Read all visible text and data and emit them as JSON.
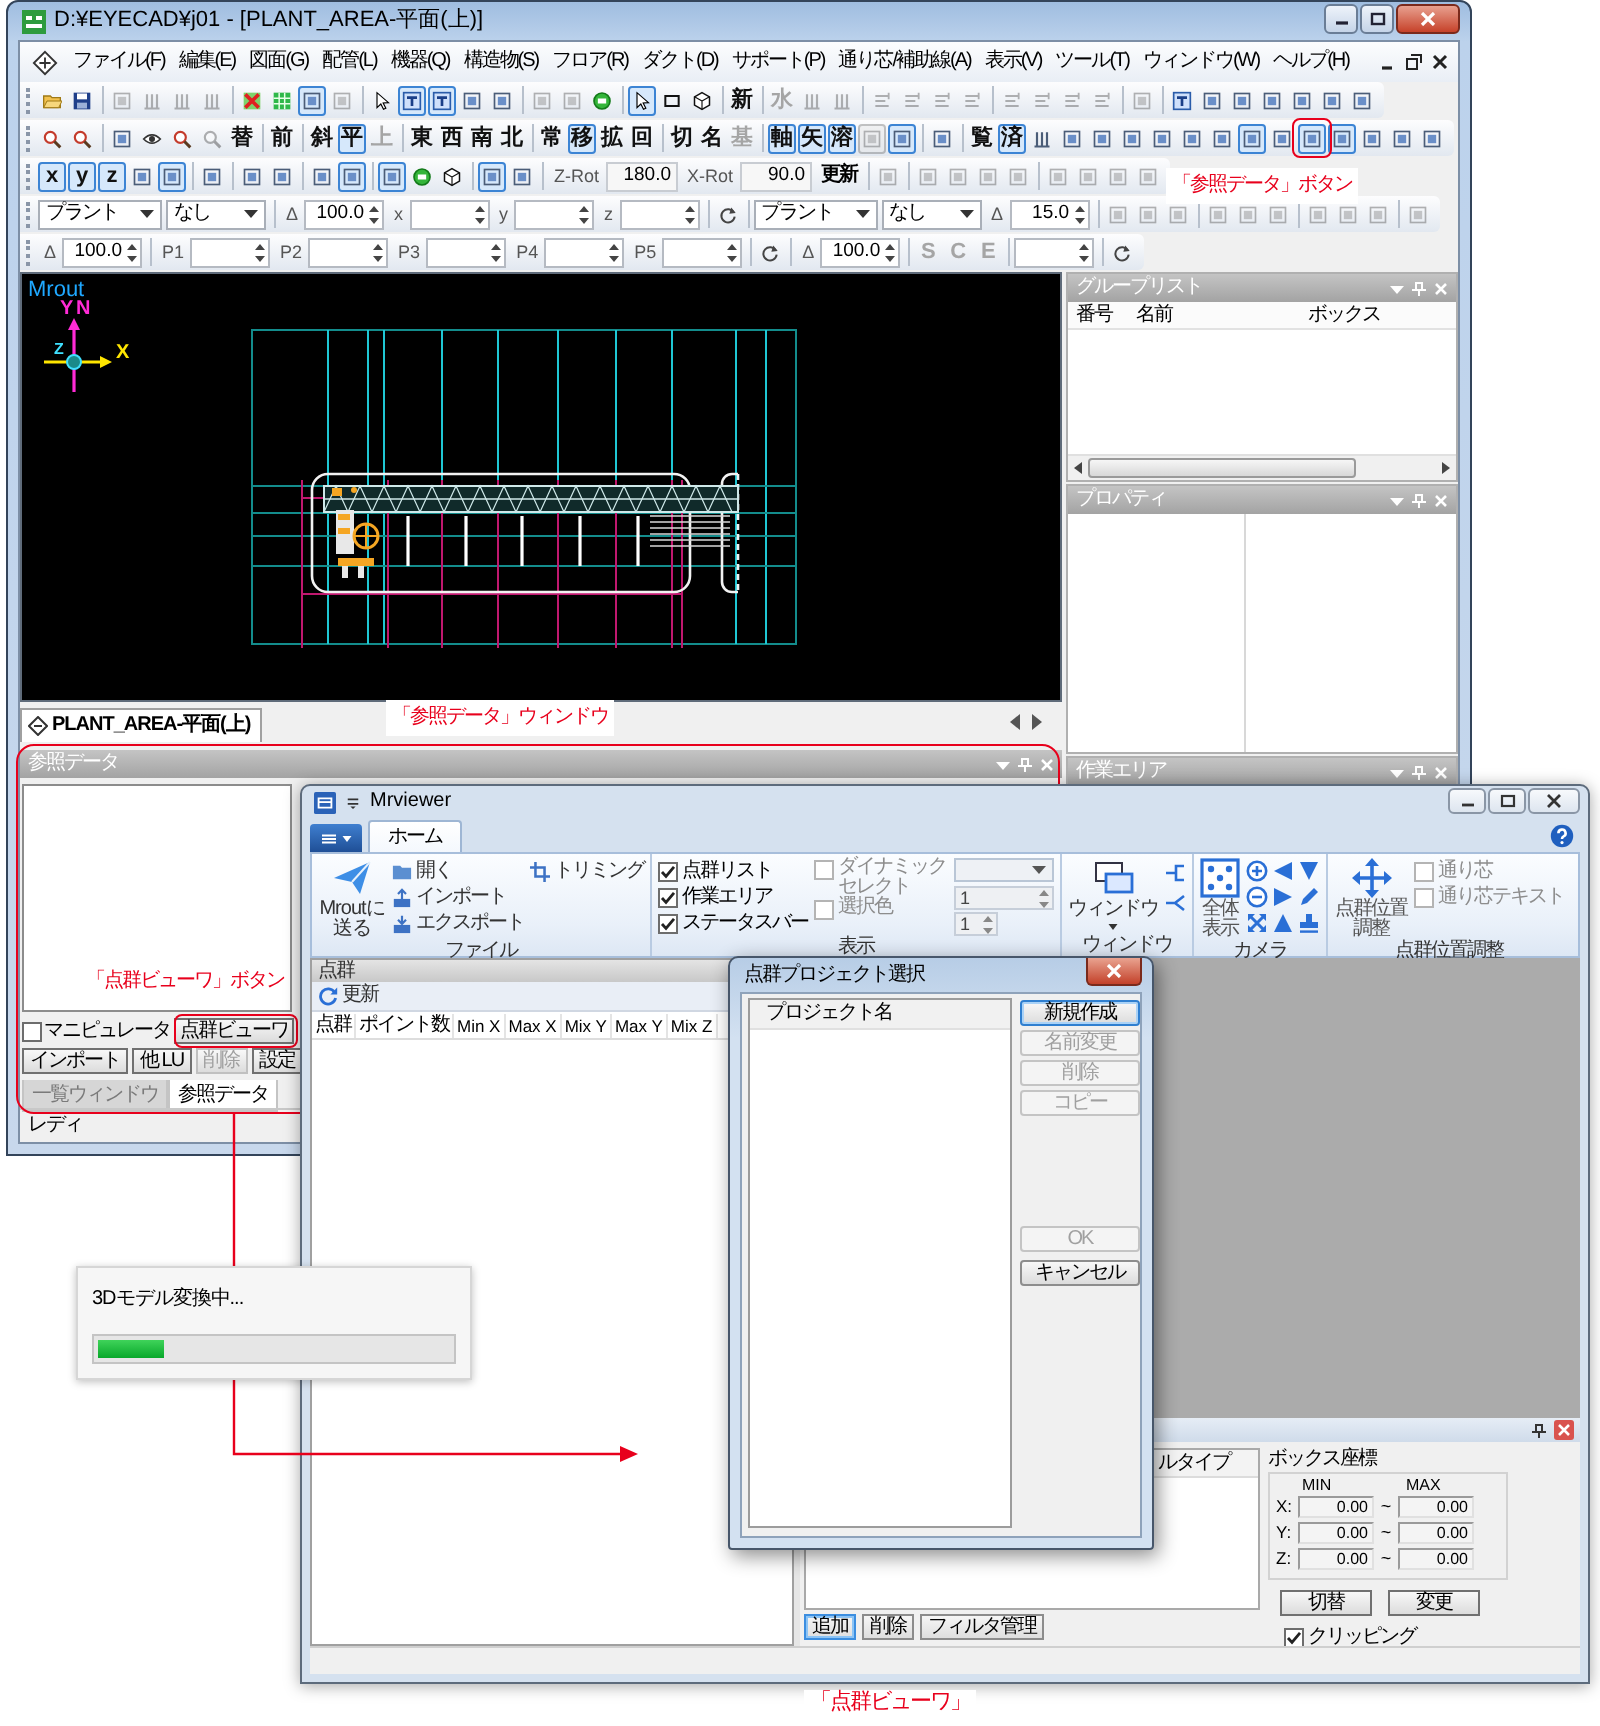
{
  "main_window": {
    "title": "D:¥EYECAD¥j01 - [PLANT_AREA-平面(上)]",
    "menu": [
      "ファイル(F)",
      "編集(E)",
      "図面(G)",
      "配管(L)",
      "機器(Q)",
      "構造物(S)",
      "フロア(R)",
      "ダクト(D)",
      "サポート(P)",
      "通り芯/補助線(A)",
      "表示(V)",
      "ツール(T)",
      "ウィンドウ(W)",
      "ヘルプ(H)"
    ],
    "toolbars": [
      {
        "groups": [
          {
            "kind": "tools",
            "items": [
              {
                "kind": "open",
                "on": false,
                "disabled": false
              },
              {
                "kind": "save",
                "on": false,
                "disabled": false
              }
            ]
          },
          {
            "kind": "tools",
            "items": [
              {
                "kind": "frame",
                "on": false,
                "disabled": true
              },
              {
                "kind": "bars",
                "on": false,
                "disabled": true
              },
              {
                "kind": "bars",
                "on": false,
                "disabled": true
              },
              {
                "kind": "bars",
                "on": false,
                "disabled": true
              }
            ]
          },
          {
            "kind": "tools",
            "items": [
              {
                "kind": "cross",
                "on": false,
                "disabled": false
              },
              {
                "kind": "grid",
                "on": false,
                "disabled": false
              },
              {
                "kind": "frame",
                "on": true,
                "disabled": false
              },
              {
                "kind": "frame",
                "on": false,
                "disabled": true
              }
            ]
          },
          {
            "kind": "tools",
            "items": [
              {
                "kind": "cursor",
                "on": false,
                "disabled": false
              },
              {
                "kind": "tee",
                "on": true,
                "disabled": false
              },
              {
                "kind": "tee",
                "on": true,
                "disabled": false
              },
              {
                "kind": "frame",
                "on": false,
                "disabled": false
              },
              {
                "kind": "frame",
                "on": false,
                "disabled": false
              }
            ]
          },
          {
            "kind": "tools",
            "items": [
              {
                "kind": "frame",
                "on": false,
                "disabled": true
              },
              {
                "kind": "frame",
                "on": false,
                "disabled": true
              },
              {
                "kind": "ring",
                "on": false,
                "disabled": false
              }
            ]
          },
          {
            "kind": "tools",
            "items": [
              {
                "kind": "cursor",
                "on": true,
                "disabled": false
              },
              {
                "kind": "rect",
                "on": false,
                "disabled": false
              },
              {
                "kind": "cube",
                "on": false,
                "disabled": false
              }
            ]
          },
          {
            "kind": "tools",
            "items": [
              {
                "kind": "glyph",
                "text": "新",
                "on": false,
                "disabled": false
              }
            ]
          },
          {
            "kind": "tools",
            "items": [
              {
                "kind": "glyph",
                "text": "水",
                "on": false,
                "disabled": true
              },
              {
                "kind": "bars",
                "on": false,
                "disabled": true
              },
              {
                "kind": "bars",
                "on": false,
                "disabled": true
              }
            ]
          },
          {
            "kind": "tools",
            "items": [
              {
                "kind": "lines",
                "on": false,
                "disabled": true
              },
              {
                "kind": "lines",
                "on": false,
                "disabled": true
              },
              {
                "kind": "lines",
                "on": false,
                "disabled": true
              },
              {
                "kind": "lines",
                "on": false,
                "disabled": true
              }
            ]
          },
          {
            "kind": "tools",
            "items": [
              {
                "kind": "lines",
                "on": false,
                "disabled": true
              },
              {
                "kind": "lines",
                "on": false,
                "disabled": true
              },
              {
                "kind": "lines",
                "on": false,
                "disabled": true
              },
              {
                "kind": "lines",
                "on": false,
                "disabled": true
              }
            ]
          },
          {
            "kind": "tools",
            "items": [
              {
                "kind": "frame",
                "on": false,
                "disabled": true
              }
            ]
          },
          {
            "kind": "tools",
            "items": [
              {
                "kind": "tee",
                "on": false,
                "disabled": false
              },
              {
                "kind": "frame",
                "on": false,
                "disabled": false
              },
              {
                "kind": "frame",
                "on": false,
                "disabled": false
              },
              {
                "kind": "frame",
                "on": false,
                "disabled": false
              },
              {
                "kind": "frame",
                "on": false,
                "disabled": false
              },
              {
                "kind": "frame",
                "on": false,
                "disabled": false
              },
              {
                "kind": "frame",
                "on": false,
                "disabled": false
              }
            ]
          }
        ]
      },
      {
        "groups": [
          {
            "kind": "tools",
            "items": [
              {
                "kind": "zoom",
                "on": false,
                "disabled": false
              },
              {
                "kind": "zoom",
                "on": false,
                "disabled": false
              }
            ]
          },
          {
            "kind": "tools",
            "items": [
              {
                "kind": "frame",
                "on": false,
                "disabled": false
              },
              {
                "kind": "eye",
                "on": false,
                "disabled": false
              },
              {
                "kind": "zoom",
                "on": false,
                "disabled": false
              },
              {
                "kind": "zoom",
                "on": false,
                "disabled": true
              },
              {
                "kind": "glyph",
                "text": "替",
                "on": false,
                "disabled": false
              }
            ]
          },
          {
            "kind": "tools",
            "items": [
              {
                "kind": "glyph",
                "text": "前",
                "on": false,
                "disabled": false
              }
            ]
          },
          {
            "kind": "tools",
            "items": [
              {
                "kind": "glyph",
                "text": "斜",
                "on": false,
                "disabled": false
              },
              {
                "kind": "glyph",
                "text": "平",
                "on": true,
                "disabled": false
              },
              {
                "kind": "glyph",
                "text": "上",
                "on": false,
                "disabled": true
              }
            ]
          },
          {
            "kind": "tools",
            "items": [
              {
                "kind": "glyph",
                "text": "東",
                "on": false,
                "disabled": false
              },
              {
                "kind": "glyph",
                "text": "西",
                "on": false,
                "disabled": false
              },
              {
                "kind": "glyph",
                "text": "南",
                "on": false,
                "disabled": false
              },
              {
                "kind": "glyph",
                "text": "北",
                "on": false,
                "disabled": false
              }
            ]
          },
          {
            "kind": "tools",
            "items": [
              {
                "kind": "glyph",
                "text": "常",
                "on": false,
                "disabled": false
              },
              {
                "kind": "glyph",
                "text": "移",
                "on": true,
                "disabled": false
              },
              {
                "kind": "glyph",
                "text": "拡",
                "on": false,
                "disabled": false
              },
              {
                "kind": "glyph",
                "text": "回",
                "on": false,
                "disabled": false
              }
            ]
          },
          {
            "kind": "tools",
            "items": [
              {
                "kind": "glyph",
                "text": "切",
                "on": false,
                "disabled": false
              },
              {
                "kind": "glyph",
                "text": "名",
                "on": false,
                "disabled": false
              },
              {
                "kind": "glyph",
                "text": "基",
                "on": false,
                "disabled": true
              }
            ]
          },
          {
            "kind": "tools",
            "items": [
              {
                "kind": "glyph",
                "text": "軸",
                "on": true,
                "disabled": false
              },
              {
                "kind": "glyph",
                "text": "矢",
                "on": true,
                "disabled": false
              },
              {
                "kind": "glyph",
                "text": "溶",
                "on": true,
                "disabled": false
              },
              {
                "kind": "frame",
                "on": true,
                "disabled": true
              },
              {
                "kind": "frame",
                "on": true,
                "disabled": false
              }
            ]
          },
          {
            "kind": "tools",
            "items": [
              {
                "kind": "frame",
                "on": false,
                "disabled": false
              }
            ]
          },
          {
            "kind": "tools",
            "items": [
              {
                "kind": "glyph",
                "text": "覧",
                "on": false,
                "disabled": false
              },
              {
                "kind": "glyph",
                "text": "済",
                "on": true,
                "disabled": false
              },
              {
                "kind": "bars",
                "on": false,
                "disabled": false
              },
              {
                "kind": "frame",
                "on": false,
                "disabled": false
              },
              {
                "kind": "frame",
                "on": false,
                "disabled": false
              },
              {
                "kind": "frame",
                "on": false,
                "disabled": false
              },
              {
                "kind": "frame",
                "on": false,
                "disabled": false
              },
              {
                "kind": "frame",
                "on": false,
                "disabled": false
              },
              {
                "kind": "frame",
                "on": false,
                "disabled": false
              },
              {
                "kind": "frame",
                "on": true,
                "disabled": false
              },
              {
                "kind": "frame",
                "on": false,
                "disabled": false
              },
              {
                "kind": "frame",
                "on": true,
                "disabled": false
              },
              {
                "kind": "frame",
                "on": true,
                "disabled": false
              },
              {
                "kind": "frame",
                "on": false,
                "disabled": false
              },
              {
                "kind": "frame",
                "on": false,
                "disabled": false
              },
              {
                "kind": "frame",
                "on": false,
                "disabled": false
              }
            ]
          }
        ]
      },
      {
        "groups": [
          {
            "kind": "tools",
            "items": [
              {
                "kind": "glyph",
                "text": "x",
                "on": true,
                "disabled": false
              },
              {
                "kind": "glyph",
                "text": "y",
                "on": true,
                "disabled": false
              },
              {
                "kind": "glyph",
                "text": "z",
                "on": true,
                "disabled": false
              },
              {
                "kind": "frame",
                "on": false,
                "disabled": false
              },
              {
                "kind": "frame",
                "on": true,
                "disabled": false
              }
            ]
          },
          {
            "kind": "tools",
            "items": [
              {
                "kind": "frame",
                "on": false,
                "disabled": false
              }
            ]
          },
          {
            "kind": "tools",
            "items": [
              {
                "kind": "frame",
                "on": false,
                "disabled": false
              },
              {
                "kind": "frame",
                "on": false,
                "disabled": false
              }
            ]
          },
          {
            "kind": "tools",
            "items": [
              {
                "kind": "frame",
                "on": false,
                "disabled": false
              },
              {
                "kind": "frame",
                "on": true,
                "disabled": false
              }
            ]
          },
          {
            "kind": "tools",
            "items": [
              {
                "kind": "frame",
                "on": true,
                "disabled": false
              },
              {
                "kind": "ring",
                "on": false,
                "disabled": false
              },
              {
                "kind": "cube",
                "on": false,
                "disabled": false
              }
            ]
          },
          {
            "kind": "tools",
            "items": [
              {
                "kind": "frame",
                "on": true,
                "disabled": false
              },
              {
                "kind": "frame",
                "on": false,
                "disabled": false
              }
            ]
          },
          {
            "kind": "fields",
            "items": [
              {
                "kind": "label",
                "text": "Z-Rot"
              },
              {
                "kind": "field",
                "value": "180.0"
              },
              {
                "kind": "label",
                "text": "X-Rot"
              },
              {
                "kind": "field",
                "value": "90.0"
              },
              {
                "kind": "button",
                "text": "更新"
              }
            ]
          },
          {
            "kind": "tools",
            "items": [
              {
                "kind": "frame",
                "on": false,
                "disabled": true
              }
            ]
          },
          {
            "kind": "tools",
            "items": [
              {
                "kind": "frame",
                "on": false,
                "disabled": true
              },
              {
                "kind": "frame",
                "on": false,
                "disabled": true
              },
              {
                "kind": "frame",
                "on": false,
                "disabled": true
              },
              {
                "kind": "frame",
                "on": false,
                "disabled": true
              }
            ]
          },
          {
            "kind": "tools",
            "items": [
              {
                "kind": "frame",
                "on": false,
                "disabled": true
              },
              {
                "kind": "frame",
                "on": false,
                "disabled": true
              },
              {
                "kind": "frame",
                "on": false,
                "disabled": true
              },
              {
                "kind": "frame",
                "on": false,
                "disabled": true
              }
            ]
          }
        ]
      },
      {
        "groups": [
          {
            "kind": "fields",
            "items": [
              {
                "kind": "combo",
                "value": "プラント"
              },
              {
                "kind": "combo",
                "value": "なし"
              }
            ]
          },
          {
            "kind": "fields",
            "items": [
              {
                "kind": "label",
                "text": "Δ"
              },
              {
                "kind": "spin",
                "value": "100.0"
              },
              {
                "kind": "label",
                "text": "x"
              },
              {
                "kind": "spin"
              },
              {
                "kind": "label",
                "text": "y"
              },
              {
                "kind": "spin"
              },
              {
                "kind": "label",
                "text": "z"
              },
              {
                "kind": "spin"
              }
            ]
          },
          {
            "kind": "tools",
            "items": [
              {
                "kind": "rotate",
                "on": false,
                "disabled": false
              }
            ]
          },
          {
            "kind": "fields",
            "items": [
              {
                "kind": "combo",
                "value": "プラント"
              },
              {
                "kind": "combo",
                "value": "なし"
              },
              {
                "kind": "label",
                "text": "Δ"
              },
              {
                "kind": "spin",
                "value": "15.0"
              }
            ]
          },
          {
            "kind": "tools",
            "items": [
              {
                "kind": "frame",
                "on": false,
                "disabled": true
              },
              {
                "kind": "frame",
                "on": false,
                "disabled": true
              },
              {
                "kind": "frame",
                "on": false,
                "disabled": true
              }
            ]
          },
          {
            "kind": "tools",
            "items": [
              {
                "kind": "frame",
                "on": false,
                "disabled": true
              },
              {
                "kind": "frame",
                "on": false,
                "disabled": true
              },
              {
                "kind": "frame",
                "on": false,
                "disabled": true
              }
            ]
          },
          {
            "kind": "tools",
            "items": [
              {
                "kind": "frame",
                "on": false,
                "disabled": true
              },
              {
                "kind": "frame",
                "on": false,
                "disabled": true
              },
              {
                "kind": "frame",
                "on": false,
                "disabled": true
              }
            ]
          },
          {
            "kind": "tools",
            "items": [
              {
                "kind": "frame",
                "on": false,
                "disabled": true
              }
            ]
          }
        ]
      },
      {
        "groups": [
          {
            "kind": "fields",
            "items": [
              {
                "kind": "label",
                "text": "Δ"
              },
              {
                "kind": "spin",
                "value": "100.0"
              }
            ]
          },
          {
            "kind": "fields",
            "items": [
              {
                "kind": "label",
                "text": "P1"
              },
              {
                "kind": "spin"
              },
              {
                "kind": "label",
                "text": "P2"
              },
              {
                "kind": "spin"
              },
              {
                "kind": "label",
                "text": "P3"
              },
              {
                "kind": "spin"
              },
              {
                "kind": "label",
                "text": "P4"
              },
              {
                "kind": "spin"
              },
              {
                "kind": "label",
                "text": "P5"
              },
              {
                "kind": "spin"
              }
            ]
          },
          {
            "kind": "tools",
            "items": [
              {
                "kind": "rotate",
                "on": false,
                "disabled": false
              }
            ]
          },
          {
            "kind": "fields",
            "items": [
              {
                "kind": "label",
                "text": "Δ"
              },
              {
                "kind": "spin",
                "value": "100.0"
              }
            ]
          },
          {
            "kind": "tools",
            "items": [
              {
                "kind": "glyph",
                "text": "S",
                "on": false,
                "disabled": true
              },
              {
                "kind": "glyph",
                "text": "C",
                "on": false,
                "disabled": true
              },
              {
                "kind": "glyph",
                "text": "E",
                "on": false,
                "disabled": true
              }
            ]
          },
          {
            "kind": "fields",
            "items": [
              {
                "kind": "spin"
              }
            ]
          },
          {
            "kind": "tools",
            "items": [
              {
                "kind": "rotate",
                "on": false,
                "disabled": false
              }
            ]
          }
        ]
      }
    ],
    "view": {
      "name": "Mrout",
      "axis_labels": [
        "Y",
        "N",
        "Z",
        "X"
      ]
    },
    "document_tabs": [
      {
        "label": "PLANT_AREA-平面(上)",
        "selected": true
      }
    ],
    "group_list": {
      "title": "グループリスト",
      "columns": [
        "番号",
        "名前",
        "ボックス"
      ]
    },
    "properties": {
      "title": "プロパティ"
    },
    "work_area": {
      "title": "作業エリア"
    },
    "reference_data": {
      "title": "参照データ",
      "manipulator": {
        "label": "マニピュレータ",
        "checked": false
      },
      "viewer_button": "点群ビューワ",
      "buttons": [
        {
          "label": "インポート",
          "disabled": false
        },
        {
          "label": "他 LU",
          "disabled": false
        },
        {
          "label": "削除",
          "disabled": true
        },
        {
          "label": "設定",
          "disabled": false
        }
      ],
      "tabs": [
        {
          "label": "一覧ウィンドウ",
          "selected": false
        },
        {
          "label": "参照データ",
          "selected": true
        }
      ]
    },
    "status_bar": "レディ"
  },
  "mrviewer": {
    "title": "Mrviewer",
    "tabs": [
      {
        "label": "ホーム",
        "selected": true
      }
    ],
    "ribbon": {
      "file": {
        "label": "ファイル",
        "send": "Mroutに送る",
        "open": "開く",
        "import": "インポート",
        "export": "エクスポート",
        "trim": "トリミング"
      },
      "display": {
        "label": "表示",
        "options": [
          {
            "label": "点群リスト",
            "checked": true,
            "disabled": false
          },
          {
            "label": "作業エリア",
            "checked": true,
            "disabled": false
          },
          {
            "label": "ステータスバー",
            "checked": true,
            "disabled": false
          },
          {
            "label": "ダイナミックセレクト",
            "checked": false,
            "disabled": true
          },
          {
            "label": "選択色",
            "checked": false,
            "disabled": true
          }
        ],
        "combo": {
          "disabled": true
        },
        "spinners": [
          {
            "value": "1",
            "disabled": true
          },
          {
            "value": "1",
            "disabled": true
          }
        ]
      },
      "window": {
        "label": "ウィンドウ",
        "button": "ウィンドウ"
      },
      "camera": {
        "label": "カメラ",
        "button": "全体表示"
      },
      "alignment": {
        "label": "点群位置調整",
        "button": "点群位置調整",
        "options": [
          {
            "label": "通り芯",
            "checked": false,
            "disabled": true
          },
          {
            "label": "通り芯テキスト",
            "checked": false,
            "disabled": true
          }
        ]
      }
    },
    "cloud_list": {
      "title": "点群",
      "refresh": "更新",
      "columns": [
        "点群",
        "ポイント数",
        "Min X",
        "Max X",
        "Mix Y",
        "Max Y",
        "Mix Z"
      ]
    },
    "filter_panel": {
      "columns": [
        "ルタイプ"
      ],
      "buttons": [
        {
          "label": "追加",
          "default": true
        },
        {
          "label": "削除",
          "default": false
        },
        {
          "label": "フィルタ管理",
          "default": false
        }
      ],
      "box": {
        "title": "ボックス座標",
        "min_label": "MIN",
        "max_label": "MAX",
        "rows": [
          {
            "axis": "X:",
            "min": "0.00",
            "to": "~",
            "max": "0.00"
          },
          {
            "axis": "Y:",
            "min": "0.00",
            "to": "~",
            "max": "0.00"
          },
          {
            "axis": "Z:",
            "min": "0.00",
            "to": "~",
            "max": "0.00"
          }
        ]
      },
      "actions": [
        "切替",
        "変更"
      ],
      "clipping": {
        "label": "クリッピング",
        "checked": true
      }
    }
  },
  "project_dialog": {
    "title": "点群プロジェクト選択",
    "list_header": "プロジェクト名",
    "buttons": [
      {
        "label": "新規作成",
        "disabled": false,
        "default": true
      },
      {
        "label": "名前変更",
        "disabled": true,
        "default": false
      },
      {
        "label": "削除",
        "disabled": true,
        "default": false
      },
      {
        "label": "コピー",
        "disabled": true,
        "default": false
      }
    ],
    "confirm": [
      {
        "label": "OK",
        "disabled": true,
        "default": false
      },
      {
        "label": "キャンセル",
        "disabled": false,
        "default": false
      }
    ]
  },
  "progress_popup": {
    "message": "3Dモデル変換中...",
    "level": 0.19
  },
  "annotations": [
    {
      "kind": "toolbar_button",
      "text": "「参照データ」ボタン",
      "framed": true,
      "arrow": false
    },
    {
      "kind": "panel",
      "text": "「参照データ」ウィンドウ",
      "framed": true,
      "arrow": false
    },
    {
      "kind": "viewer_button",
      "text": "「点群ビューワ」ボタン",
      "framed": true,
      "arrow": true
    },
    {
      "kind": "viewer",
      "text": "「点群ビューワ」",
      "framed": false,
      "arrow": false
    }
  ]
}
